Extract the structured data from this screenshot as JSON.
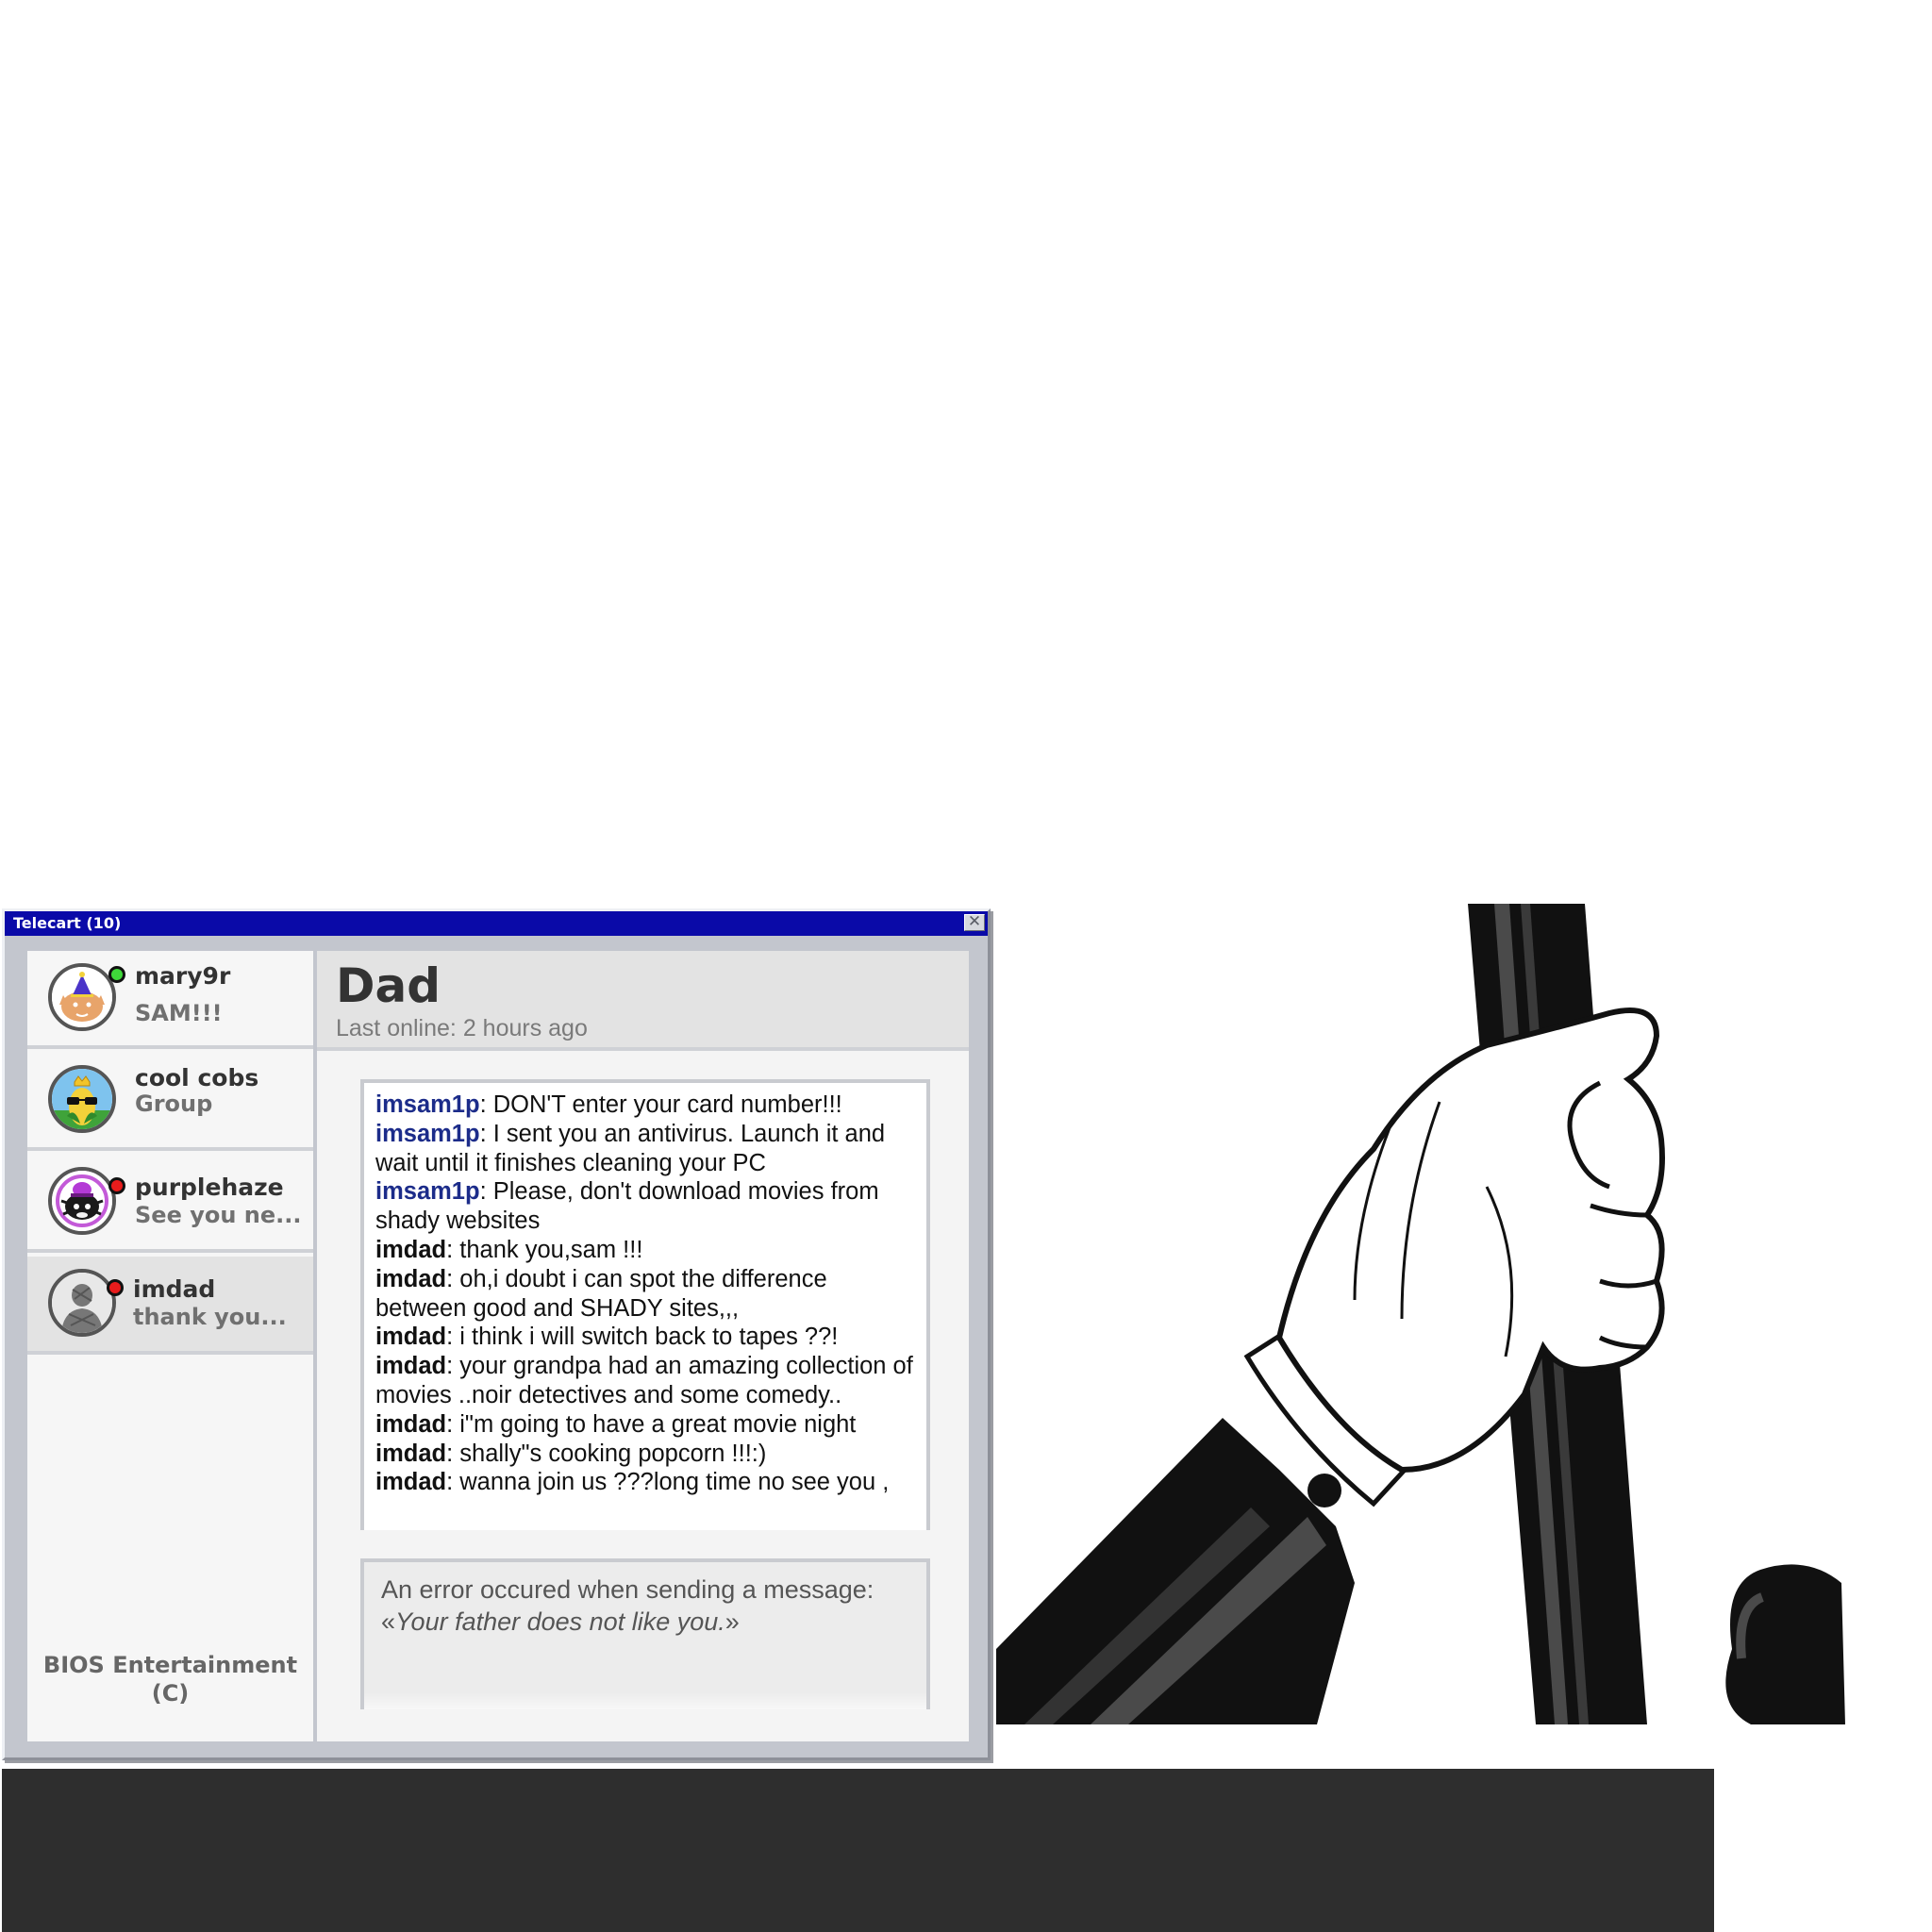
{
  "window": {
    "title": "Telecart (10)",
    "close_glyph": "✕"
  },
  "contacts": [
    {
      "name": "mary9r",
      "status": "online",
      "preview": "SAM!!!",
      "avatar_icon": "party-hat-cat-avatar-icon"
    },
    {
      "name": "cool cobs",
      "status": "",
      "preview": "Group",
      "avatar_icon": "crowned-corn-sunglasses-avatar-icon"
    },
    {
      "name": "purplehaze",
      "status": "offline",
      "preview": "See you ne...",
      "avatar_icon": "purple-hat-creature-avatar-icon"
    },
    {
      "name": "imdad",
      "status": "offline",
      "preview": "thank you...",
      "avatar_icon": "grey-sketch-avatar-icon",
      "active": true
    }
  ],
  "sidebar_footer": {
    "line1": "BIOS Entertainment",
    "line2": "(C)"
  },
  "chat": {
    "title": "Dad",
    "subtitle": "Last online: 2 hours ago",
    "messages": [
      {
        "sender": "imsam1p",
        "text": ": DON'T enter your card number!!!"
      },
      {
        "sender": "imsam1p",
        "text": ": I sent you an antivirus. Launch it and wait until it finishes cleaning your PC"
      },
      {
        "sender": "imsam1p",
        "text": ": Please, don't download movies from shady websites"
      },
      {
        "sender": "imdad",
        "text": ": thank you,sam !!!"
      },
      {
        "sender": "imdad",
        "text": ": oh,i doubt i can spot the difference between good and SHADY sites,,,"
      },
      {
        "sender": "imdad",
        "text": ": i think i will switch back to tapes ??!"
      },
      {
        "sender": "imdad",
        "text": ": your grandpa had an amazing collection of movies ..noir detectives and some comedy.."
      },
      {
        "sender": "imdad",
        "text": ": i\"m going to have a great movie night"
      },
      {
        "sender": "imdad",
        "text": ": shally\"s cooking popcorn !!!:)"
      },
      {
        "sender": "imdad",
        "text": ": wanna join us ???long time no see you ,"
      }
    ],
    "error": {
      "prefix": "An error occured when sending a message: «",
      "quote": "Your father does not like you.",
      "suffix": "»"
    }
  },
  "colors": {
    "titlebar": "#0a0aa8",
    "online": "#3fd83a",
    "offline": "#e81c1c",
    "self_sender": "#1c2c8a",
    "bottom_bar": "#2e2e2e"
  },
  "illustration_icon": "gloved-hand-gripping-cane-icon"
}
